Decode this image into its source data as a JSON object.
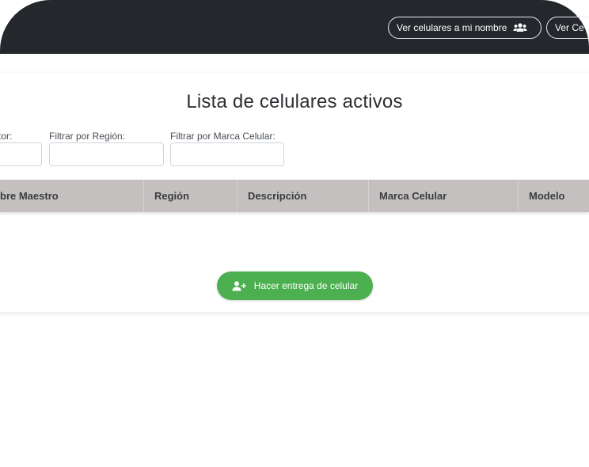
{
  "header": {
    "btn_my_phones": "Ver celulares a mi nombre",
    "btn_other": "Ver Ce",
    "my_phones_icon": "users-icon"
  },
  "page": {
    "title": "Lista de celulares activos"
  },
  "filters": [
    {
      "label": "tor:",
      "value": "",
      "placeholder": ""
    },
    {
      "label": "Filtrar por Región:",
      "value": "",
      "placeholder": ""
    },
    {
      "label": "Filtrar por Marca Celular:",
      "value": "",
      "placeholder": ""
    }
  ],
  "table": {
    "columns": [
      "bre Maestro",
      "Región",
      "Descripción",
      "Marca Celular",
      "Modelo"
    ],
    "rows": []
  },
  "actions": {
    "deliver_label": "Hacer entrega de celular",
    "deliver_icon": "user-plus-icon"
  },
  "colors": {
    "header_bg": "#24272b",
    "table_header_bg": "#c4c0c0",
    "accent_green": "#4caf50"
  }
}
